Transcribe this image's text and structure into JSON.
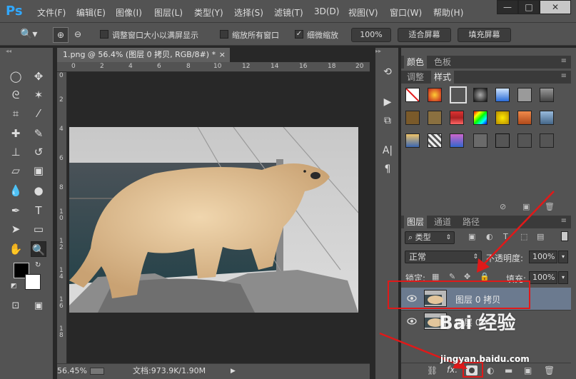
{
  "app": {
    "logo": "Ps"
  },
  "menu": [
    "文件(F)",
    "编辑(E)",
    "图像(I)",
    "图层(L)",
    "类型(Y)",
    "选择(S)",
    "滤镜(T)",
    "3D(D)",
    "视图(V)",
    "窗口(W)",
    "帮助(H)"
  ],
  "window_controls": {
    "minimize": "—",
    "maximize": "□",
    "close": "✕"
  },
  "options": {
    "resize_windows_label": "调整窗口大小以满屏显示",
    "zoom_all_label": "缩放所有窗口",
    "scrubby_zoom_label": "细微缩放",
    "zoom_100_label": "100%",
    "fit_screen_label": "适合屏幕",
    "fill_screen_label": "填充屏幕"
  },
  "document": {
    "tab_title": "1.png @ 56.4% (图层 0 拷贝, RGB/8#) *",
    "tab_close": "×",
    "ruler_top": [
      "0",
      "2",
      "4",
      "6",
      "8",
      "10",
      "12",
      "14",
      "16",
      "18",
      "20"
    ],
    "ruler_left": [
      "0",
      "2",
      "4",
      "6",
      "8",
      "1\n0",
      "1\n2",
      "1\n4",
      "1\n6",
      "1\n8"
    ],
    "status_zoom": "56.45%",
    "status_doc": "文档:973.9K/1.90M"
  },
  "color_panel": {
    "tabs": [
      "颜色",
      "色板"
    ]
  },
  "styles_panel": {
    "tabs": [
      "调整",
      "样式"
    ]
  },
  "layers_panel": {
    "tabs": [
      "图层",
      "通道",
      "路径"
    ],
    "filter_kind": "类型",
    "blend_mode": "正常",
    "opacity_label": "不透明度:",
    "opacity_value": "100%",
    "lock_label": "锁定:",
    "fill_label": "填充:",
    "fill_value": "100%",
    "layers": [
      {
        "name": "图层 0 拷贝",
        "selected": true
      },
      {
        "name": "图层 0",
        "selected": false
      }
    ],
    "footer_fx": "fx."
  },
  "watermark": {
    "brand": "Bai 经验",
    "url": "jingyan.baidu.com"
  },
  "colors": {
    "accent_red": "#e01919",
    "ps_blue": "#31a8ff",
    "selected_layer": "#6b7a8f"
  }
}
